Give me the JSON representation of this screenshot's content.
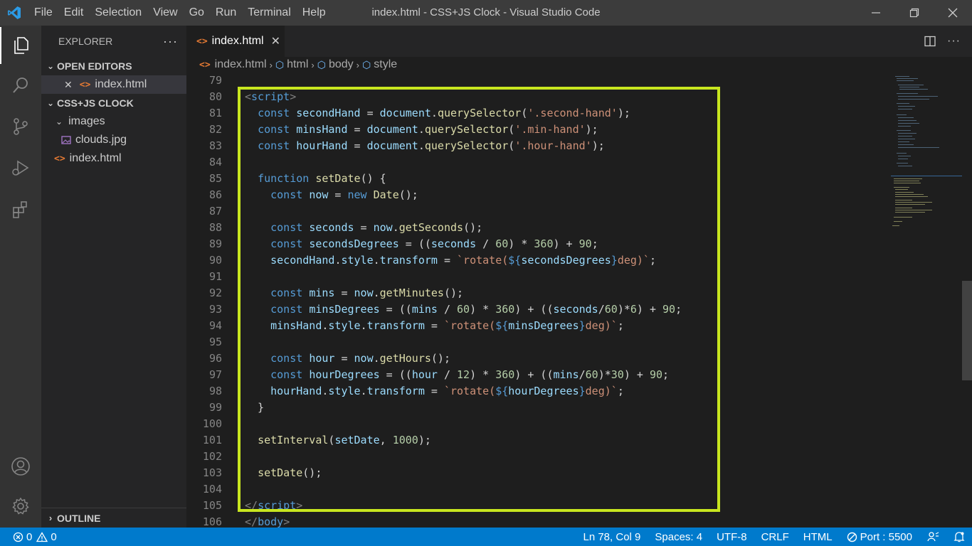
{
  "window": {
    "title": "index.html - CSS+JS Clock - Visual Studio Code",
    "menu": [
      "File",
      "Edit",
      "Selection",
      "View",
      "Go",
      "Run",
      "Terminal",
      "Help"
    ]
  },
  "activity_bar": {
    "items": [
      "explorer-icon",
      "search-icon",
      "source-control-icon",
      "run-debug-icon",
      "extensions-icon"
    ],
    "bottom": [
      "account-icon",
      "settings-gear-icon"
    ]
  },
  "sidebar": {
    "title": "EXPLORER",
    "more": "···",
    "open_editors": {
      "label": "OPEN EDITORS",
      "items": [
        {
          "name": "index.html",
          "close": "✕"
        }
      ]
    },
    "project": {
      "label": "CSS+JS CLOCK",
      "tree": [
        {
          "name": "images",
          "type": "folder"
        },
        {
          "name": "clouds.jpg",
          "type": "image"
        },
        {
          "name": "index.html",
          "type": "html"
        }
      ]
    },
    "outline": "OUTLINE"
  },
  "editor": {
    "tab": {
      "label": "index.html",
      "close": "✕"
    },
    "breadcrumbs": [
      "index.html",
      "html",
      "body",
      "style"
    ],
    "line_numbers": [
      "79",
      "80",
      "81",
      "82",
      "83",
      "84",
      "85",
      "86",
      "87",
      "88",
      "89",
      "90",
      "91",
      "92",
      "93",
      "94",
      "95",
      "96",
      "97",
      "98",
      "99",
      "100",
      "101",
      "102",
      "103",
      "104",
      "105",
      "106"
    ]
  },
  "status_bar": {
    "errors": "0",
    "warnings": "0",
    "position": "Ln 78, Col 9",
    "spaces": "Spaces: 4",
    "encoding": "UTF-8",
    "eol": "CRLF",
    "language": "HTML",
    "port": "Port : 5500"
  },
  "colors": {
    "highlight_border": "#c8e61f",
    "status_bar": "#007acc",
    "keyword": "#569cd6",
    "string": "#ce9178",
    "number": "#b5cea8",
    "function": "#dcdcaa",
    "variable": "#9cdcfe"
  }
}
